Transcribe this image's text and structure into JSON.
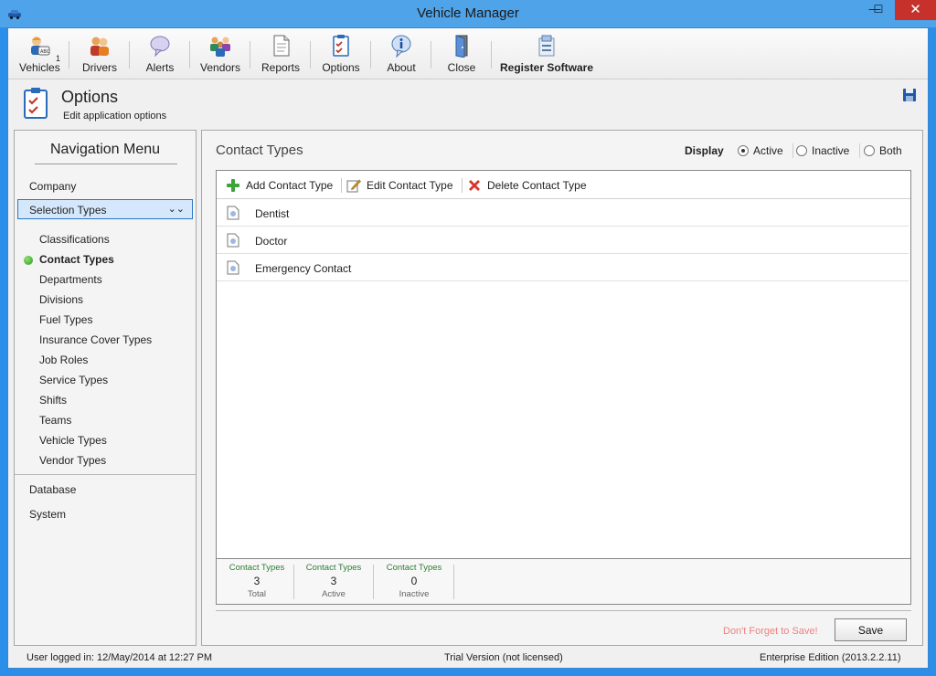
{
  "window": {
    "title": "Vehicle Manager",
    "minimize": "—",
    "maximize": "☐",
    "close": "✕"
  },
  "toolbar": {
    "vehicles": "Vehicles",
    "vehicles_count": "1",
    "drivers": "Drivers",
    "alerts": "Alerts",
    "vendors": "Vendors",
    "reports": "Reports",
    "options": "Options",
    "about": "About",
    "close": "Close",
    "register": "Register Software"
  },
  "header": {
    "title": "Options",
    "subtitle": "Edit application options"
  },
  "nav": {
    "title": "Navigation Menu",
    "company": "Company",
    "selection_types": "Selection Types",
    "items": [
      "Classifications",
      "Contact Types",
      "Departments",
      "Divisions",
      "Fuel Types",
      "Insurance Cover Types",
      "Job Roles",
      "Service Types",
      "Shifts",
      "Teams",
      "Vehicle Types",
      "Vendor Types"
    ],
    "database": "Database",
    "system": "System"
  },
  "main": {
    "title": "Contact Types",
    "display_label": "Display",
    "radio": {
      "active": "Active",
      "inactive": "Inactive",
      "both": "Both"
    },
    "actions": {
      "add": "Add Contact Type",
      "edit": "Edit Contact Type",
      "delete": "Delete Contact Type"
    },
    "rows": [
      "Dentist",
      "Doctor",
      "Emergency Contact"
    ],
    "stats": [
      {
        "label": "Contact Types",
        "value": "3",
        "caption": "Total"
      },
      {
        "label": "Contact Types",
        "value": "3",
        "caption": "Active"
      },
      {
        "label": "Contact Types",
        "value": "0",
        "caption": "Inactive"
      }
    ],
    "reminder": "Don't Forget to Save!",
    "save": "Save"
  },
  "status": {
    "user": "User logged in:  12/May/2014 at 12:27 PM",
    "license": "Trial Version (not licensed)",
    "edition": "Enterprise Edition (2013.2.2.11)"
  },
  "colors": {
    "titlebar": "#4fa3e8",
    "selection_border": "#2a76c8",
    "active_dot": "#2c9b1e",
    "reminder": "#f08080"
  }
}
